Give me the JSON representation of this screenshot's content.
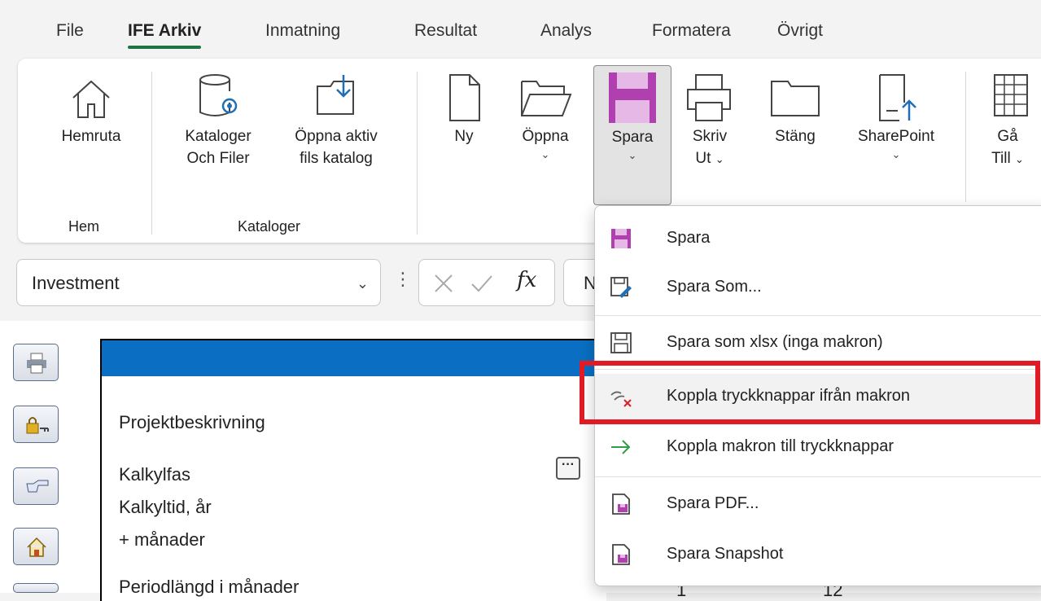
{
  "menu": {
    "tabs": [
      {
        "label": "File"
      },
      {
        "label": "IFE Arkiv"
      },
      {
        "label": "Inmatning"
      },
      {
        "label": "Resultat"
      },
      {
        "label": "Analys"
      },
      {
        "label": "Formatera"
      },
      {
        "label": "Övrigt"
      }
    ],
    "active_tab": "IFE Arkiv"
  },
  "ribbon": {
    "groups": {
      "hem": "Hem",
      "kataloger": "Kataloger"
    },
    "buttons": {
      "hemruta": {
        "line1": "Hemruta",
        "icon": "home-icon"
      },
      "kataloger": {
        "line1": "Kataloger",
        "line2": "Och Filer",
        "icon": "database-gear-icon"
      },
      "oppna_aktiv": {
        "line1": "Öppna aktiv",
        "line2": "fils katalog",
        "icon": "folder-download-icon"
      },
      "ny": {
        "line1": "Ny",
        "icon": "new-document-icon"
      },
      "oppna": {
        "line1": "Öppna",
        "icon": "open-folder-icon"
      },
      "spara": {
        "line1": "Spara",
        "icon": "save-icon"
      },
      "skriv": {
        "line1": "Skriv",
        "line2": "Ut",
        "icon": "printer-icon"
      },
      "stang": {
        "line1": "Stäng",
        "icon": "close-folder-icon"
      },
      "sharepoint": {
        "line1": "SharePoint",
        "icon": "upload-icon"
      },
      "ga_till": {
        "line1": "Gå",
        "line2": "Till",
        "icon": "table-icon"
      }
    },
    "chevron": "⌄"
  },
  "formula_bar": {
    "name_box": "Investment",
    "formula_partial": "N",
    "fx": "fx"
  },
  "sheet": {
    "labels": {
      "projekt": "Projektbeskrivning",
      "kalkylfas": "Kalkylfas",
      "kalkyltid": "Kalkyltid, år",
      "manader": "+ månader",
      "periodlangd": "Periodlängd i månader"
    },
    "ellipsis": "···",
    "row_values": [
      "1",
      "12"
    ]
  },
  "dropdown": {
    "items": [
      {
        "label": "Spara",
        "icon": "save-icon"
      },
      {
        "label": "Spara Som...",
        "icon": "save-as-icon"
      },
      {
        "label": "Spara som xlsx (inga makron)",
        "icon": "save-outline-icon"
      },
      {
        "label": "Koppla tryckknappar ifrån makron",
        "icon": "unlink-icon"
      },
      {
        "label": "Koppla makron till tryckknappar",
        "icon": "arrow-right-icon"
      },
      {
        "label": "Spara PDF...",
        "icon": "pdf-save-icon"
      },
      {
        "label": "Spara Snapshot",
        "icon": "snapshot-save-icon"
      }
    ]
  },
  "colors": {
    "accent_green": "#217346",
    "save_purple": "#b040b0",
    "highlight_red": "#e01b24",
    "panel_blue": "#0a6fc2"
  }
}
